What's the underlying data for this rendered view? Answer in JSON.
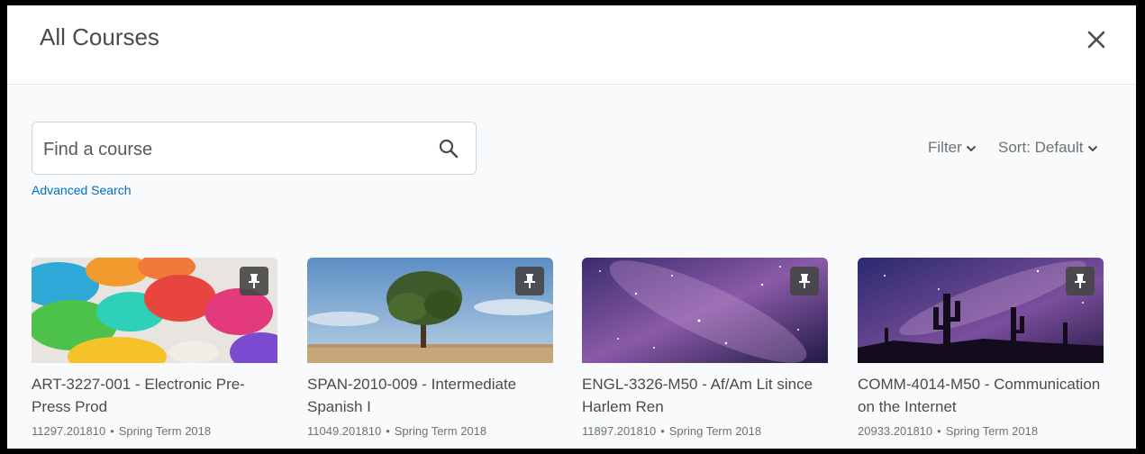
{
  "dialog": {
    "title": "All Courses"
  },
  "search": {
    "placeholder": "Find a course",
    "advanced_label": "Advanced Search"
  },
  "controls": {
    "filter_label": "Filter",
    "sort_label": "Sort: Default"
  },
  "courses": [
    {
      "name": "ART-3227-001 - Electronic Pre-Press Prod",
      "code": "11297.201810",
      "term": "Spring Term 2018",
      "image": "watercolor-palette"
    },
    {
      "name": "SPAN-2010-009 - Intermediate Spanish I",
      "code": "11049.201810",
      "term": "Spring Term 2018",
      "image": "tree-in-field"
    },
    {
      "name": "ENGL-3326-M50 - Af/Am Lit since Harlem Ren",
      "code": "11897.201810",
      "term": "Spring Term 2018",
      "image": "milky-way"
    },
    {
      "name": "COMM-4014-M50 - Communication on the Internet",
      "code": "20933.201810",
      "term": "Spring Term 2018",
      "image": "desert-night-sky"
    }
  ],
  "icons": {
    "close": "close-icon",
    "search": "search-icon",
    "chevron": "chevron-down-icon",
    "pin": "pin-icon"
  },
  "colors": {
    "link": "#006fbf",
    "text": "#494c4e",
    "muted": "#6e7376"
  }
}
